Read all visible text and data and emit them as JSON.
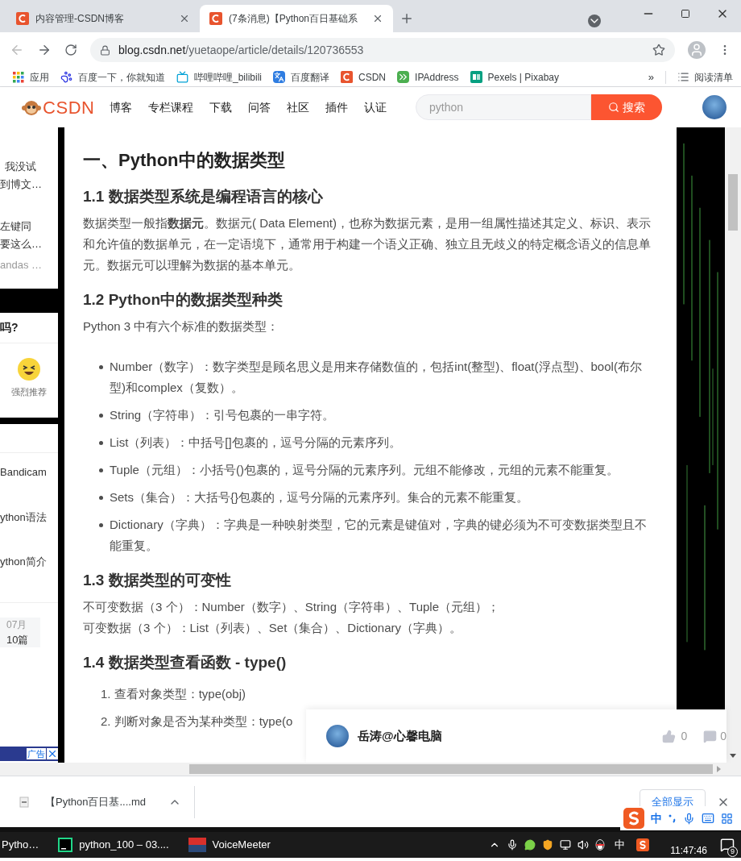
{
  "browser": {
    "tabs": [
      {
        "title": "内容管理-CSDN博客",
        "selected": false
      },
      {
        "title": "(7条消息)【Python百日基础系",
        "selected": true
      }
    ],
    "address": {
      "host": "blog.csdn.net",
      "path": "/yuetaope/article/details/120736553"
    },
    "bookmarks": [
      {
        "label": "应用",
        "kind": "apps"
      },
      {
        "label": "百度一下，你就知道",
        "kind": "paw"
      },
      {
        "label": "哔哩哔哩_bilibili",
        "kind": "tv"
      },
      {
        "label": "百度翻译",
        "kind": "translate"
      },
      {
        "label": "CSDN",
        "kind": "csdn"
      },
      {
        "label": "IPAddress",
        "kind": "chevrons"
      },
      {
        "label": "Pexels | Pixabay",
        "kind": "px"
      }
    ],
    "bookmarks_more": "»",
    "reading_list": "阅读清单"
  },
  "site_header": {
    "logo": "CSDN",
    "nav": [
      "博客",
      "专栏课程",
      "下载",
      "问答",
      "社区",
      "插件",
      "认证"
    ],
    "search": {
      "value": "python",
      "button": "搜索"
    }
  },
  "sidebar": {
    "snippets": [
      "我没试",
      "到博文…",
      "左键同",
      "要这么…",
      "andas …"
    ],
    "question": "吗?",
    "reaction": "强烈推荐",
    "links": [
      "Bandicam",
      "ython语法",
      "ython简介"
    ],
    "archive": {
      "month": "07月",
      "count": "10篇"
    },
    "ad": "广告"
  },
  "article": {
    "blocks": [
      {
        "kind": "h1",
        "text": "一、Python中的数据类型"
      },
      {
        "kind": "h2",
        "text": "1.1 数据类型系统是编程语言的核心"
      },
      {
        "kind": "p",
        "text": "数据类型一般指**数据元**。数据元( Data Element)，也称为数据元素，是用一组属性描述其定义、标识、表示和允许值的数据单元，在一定语境下，通常用于构建一个语义正确、独立且无歧义的特定概念语义的信息单元。数据元可以理解为数据的基本单元。"
      },
      {
        "kind": "h2",
        "text": "1.2 Python中的数据类型种类"
      },
      {
        "kind": "p",
        "text": "Python 3 中有六个标准的数据类型："
      },
      {
        "kind": "ul",
        "items": [
          "Number（数字）：数字类型是顾名思义是用来存储数值的，包括int(整型)、float(浮点型)、bool(布尔型)和complex（复数）。",
          "String（字符串）：引号包裹的一串字符。",
          "List（列表）：中括号[]包裹的，逗号分隔的元素序列。",
          "Tuple（元组）：小括号()包裹的，逗号分隔的元素序列。元组不能修改，元组的元素不能重复。",
          "Sets（集合）：大括号{}包裹的，逗号分隔的元素序列。集合的元素不能重复。",
          "Dictionary（字典）：字典是一种映射类型，它的元素是键值对，字典的键必须为不可变数据类型且不能重复。"
        ]
      },
      {
        "kind": "h2",
        "text": "1.3 数据类型的可变性"
      },
      {
        "kind": "lines",
        "items": [
          "不可变数据（3 个）：Number（数字）、String（字符串）、Tuple（元组）；",
          "可变数据（3 个）：List（列表）、Set（集合）、Dictionary（字典）。"
        ]
      },
      {
        "kind": "h2",
        "text": "1.4 数据类型查看函数 - type()"
      },
      {
        "kind": "ol",
        "items": [
          "1. 查看对象类型：type(obj)",
          "2. 判断对象是否为某种类型：type(o"
        ]
      }
    ]
  },
  "author_bar": {
    "name": "岳涛@心馨电脑",
    "likes": "0",
    "comments": "0"
  },
  "downloads": {
    "file": "【Python百日基....md",
    "show_all": "全部显示"
  },
  "ime": {
    "mode": "中"
  },
  "taskbar": {
    "apps": [
      {
        "label": "Pytho…",
        "kind": "plain"
      },
      {
        "label": "python_100 – 03....",
        "kind": "pycharm"
      },
      {
        "label": "VoiceMeeter",
        "kind": "voicemeeter"
      }
    ],
    "tray_lang": "中",
    "time": "11:47:46",
    "notifications": "9"
  }
}
